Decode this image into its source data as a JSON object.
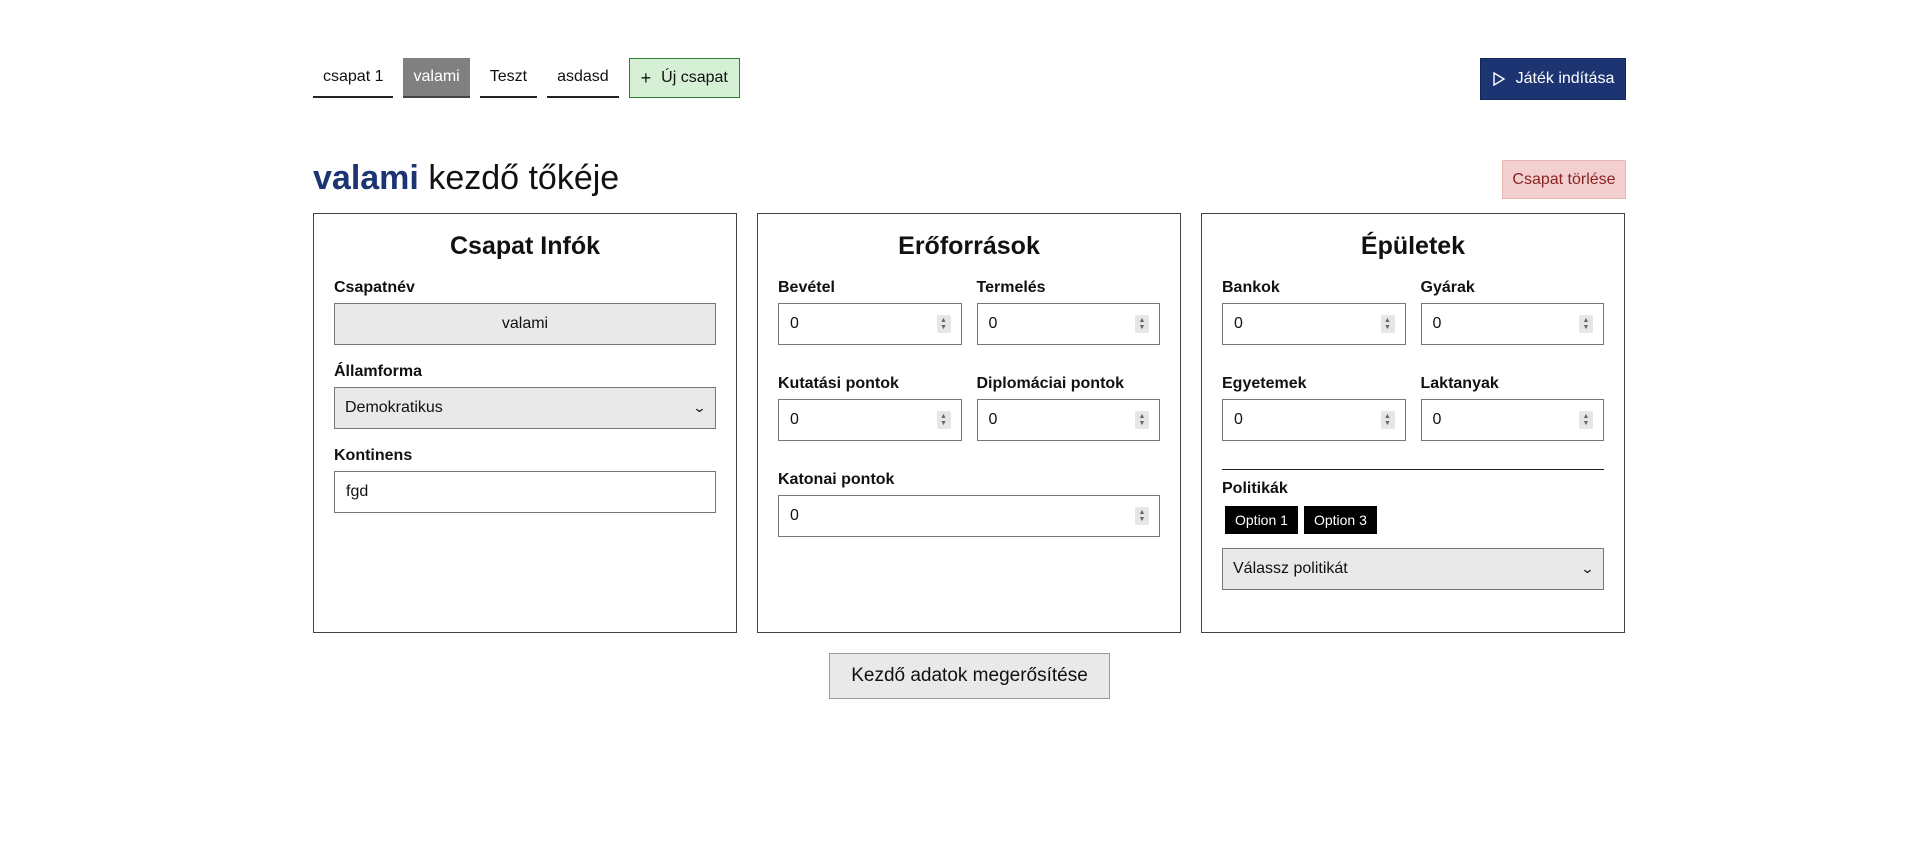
{
  "tabs": [
    {
      "label": "csapat 1",
      "active": false
    },
    {
      "label": "valami",
      "active": true
    },
    {
      "label": "Teszt",
      "active": false
    },
    {
      "label": "asdasd",
      "active": false
    }
  ],
  "new_team": {
    "label": "Új csapat",
    "icon": "plus-icon"
  },
  "start_game": {
    "label": "Játék indítása",
    "icon": "play-icon"
  },
  "heading": {
    "team_name": "valami",
    "suffix": "kezdő tőkéje"
  },
  "delete_team": {
    "label": "Csapat törlése"
  },
  "team_info": {
    "title": "Csapat Infók",
    "name_label": "Csapatnév",
    "name_value": "valami",
    "government_label": "Államforma",
    "government_value": "Demokratikus",
    "continent_label": "Kontinens",
    "continent_value": "fgd"
  },
  "resources": {
    "title": "Erőforrások",
    "income_label": "Bevétel",
    "income_value": "0",
    "production_label": "Termelés",
    "production_value": "0",
    "research_label": "Kutatási pontok",
    "research_value": "0",
    "diplomacy_label": "Diplomáciai pontok",
    "diplomacy_value": "0",
    "military_label": "Katonai pontok",
    "military_value": "0"
  },
  "buildings": {
    "title": "Épületek",
    "banks_label": "Bankok",
    "banks_value": "0",
    "factories_label": "Gyárak",
    "factories_value": "0",
    "universities_label": "Egyetemek",
    "universities_value": "0",
    "barracks_label": "Laktanyak",
    "barracks_value": "0",
    "policies_label": "Politikák",
    "policy_chips": [
      "Option 1",
      "Option 3"
    ],
    "policy_select_value": "Válassz politikát"
  },
  "confirm": {
    "label": "Kezdő adatok megerősítése"
  },
  "colors": {
    "brand": "#1d3473",
    "new_team_bg": "#d6f0d6",
    "delete_bg": "#f3cfcf",
    "active_tab": "#808080"
  }
}
